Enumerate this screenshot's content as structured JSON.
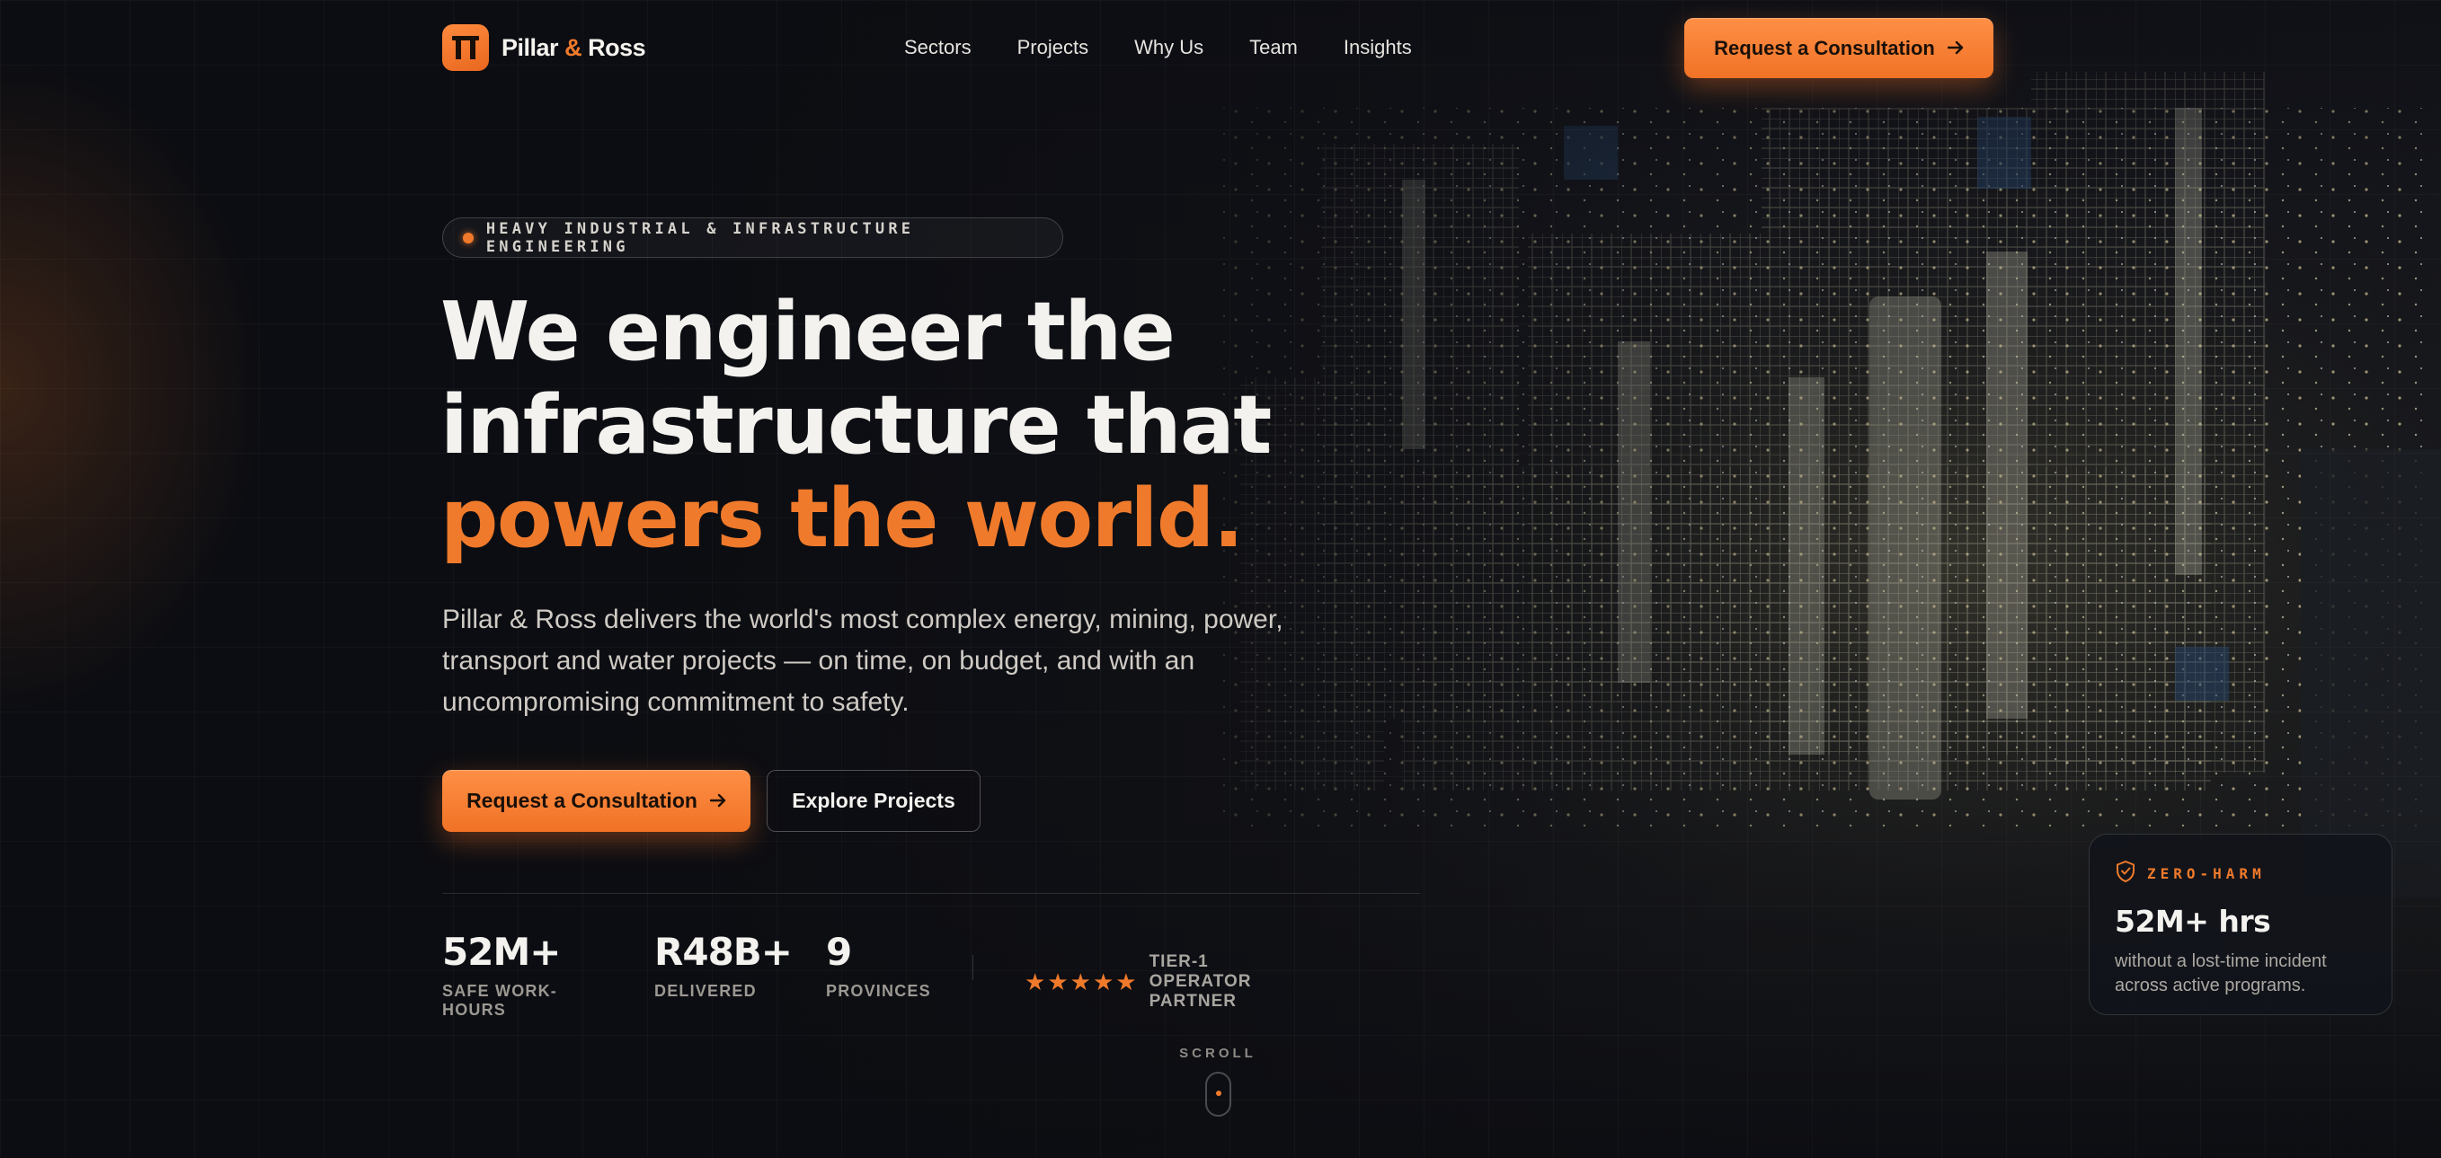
{
  "brand": {
    "name_part1": "Pillar",
    "ampersand": "&",
    "name_part2": "Ross",
    "logo_icon": "pillar-logo-icon",
    "accent_color": "#f07a2b"
  },
  "nav": {
    "links": [
      "Sectors",
      "Projects",
      "Why Us",
      "Team",
      "Insights"
    ],
    "cta_label": "Request a Consultation",
    "cta_icon": "arrow-right-icon"
  },
  "hero": {
    "eyebrow": "HEAVY INDUSTRIAL & INFRASTRUCTURE ENGINEERING",
    "headline_line1": "We engineer the",
    "headline_line2": "infrastructure that",
    "headline_accent": "powers the world.",
    "lede": "Pillar & Ross delivers the world's most complex energy, mining, power, transport and water projects — on time, on budget, and with an uncompromising commitment to safety.",
    "primary_cta": "Request a Consultation",
    "secondary_cta": "Explore Projects"
  },
  "stats": [
    {
      "value": "52M+",
      "label": "SAFE WORK-HOURS"
    },
    {
      "value": "R48B+",
      "label": "DELIVERED"
    },
    {
      "value": "9",
      "label": "PROVINCES"
    }
  ],
  "rating": {
    "stars": 5,
    "icon": "star-icon",
    "label": "TIER-1 OPERATOR PARTNER"
  },
  "zero_harm": {
    "icon": "shield-check-icon",
    "tag": "ZERO-HARM",
    "value": "52M+ hrs",
    "description": "without a lost-time incident across active programs."
  },
  "scroll": {
    "label": "SCROLL"
  },
  "colors": {
    "background": "#0c0d12",
    "accent": "#f07a2b",
    "text": "#f4f2ee",
    "muted": "#9c9892"
  }
}
